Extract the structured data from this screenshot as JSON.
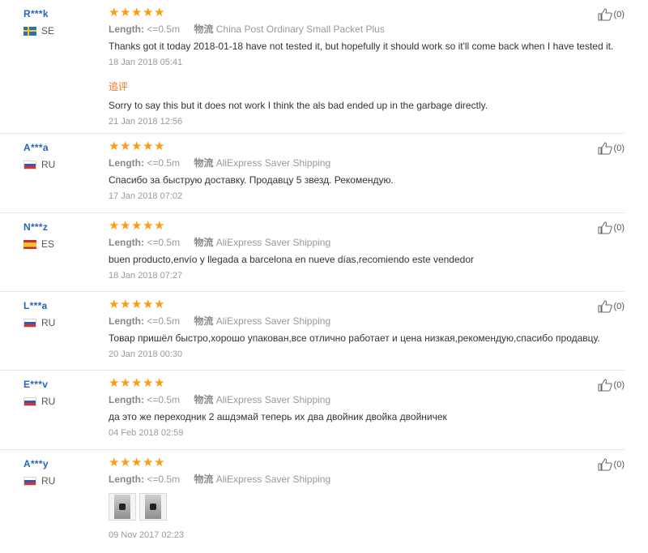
{
  "labels": {
    "length": "Length:",
    "logistics": "物流",
    "followup": "追评"
  },
  "reviews": [
    {
      "user": "R***k",
      "country": "SE",
      "flag": "se",
      "stars": 5,
      "length": "<=0.5m",
      "shipping": "China Post Ordinary Small Packet Plus",
      "text": "Thanks got it today 2018-01-18 have not tested it, but hopefully it should work so it'll come back when I have tested it.",
      "date": "18 Jan 2018 05:41",
      "followup_text": "Sorry to say this but it does not work I think the als bad ended up in the garbage directly.",
      "followup_date": "21 Jan 2018 12:56",
      "likes": "(0)"
    },
    {
      "user": "A***a",
      "country": "RU",
      "flag": "ru",
      "stars": 5,
      "length": "<=0.5m",
      "shipping": "AliExpress Saver Shipping",
      "text": "Спасибо за быструю доставку. Продавцу 5 звезд. Рекомендую.",
      "date": "17 Jan 2018 07:02",
      "likes": "(0)"
    },
    {
      "user": "N***z",
      "country": "ES",
      "flag": "es",
      "stars": 5,
      "length": "<=0.5m",
      "shipping": "AliExpress Saver Shipping",
      "text": "buen producto,envío y llegada a barcelona en nueve días,recomiendo este vendedor",
      "date": "18 Jan 2018 07:27",
      "likes": "(0)"
    },
    {
      "user": "L***a",
      "country": "RU",
      "flag": "ru",
      "stars": 5,
      "length": "<=0.5m",
      "shipping": "AliExpress Saver Shipping",
      "text": "Товар пришёл быстро,хорошо упакован,все отлично работает и цена низкая,рекомендую,спасибо продавцу.",
      "date": "20 Jan 2018 00:30",
      "likes": "(0)"
    },
    {
      "user": "E***v",
      "country": "RU",
      "flag": "ru",
      "stars": 5,
      "length": "<=0.5m",
      "shipping": "AliExpress Saver Shipping",
      "text": "да это же переходник 2 ашдэмай теперь их два двойник двойка двойничек",
      "date": "04 Feb 2018 02:59",
      "likes": "(0)"
    },
    {
      "user": "A***y",
      "country": "RU",
      "flag": "ru",
      "stars": 5,
      "length": "<=0.5m",
      "shipping": "AliExpress Saver Shipping",
      "photos": 2,
      "date": "09 Nov 2017 02:23",
      "likes": "(0)"
    }
  ],
  "colors": {
    "star": "#ff9b11",
    "username": "#2a63b8",
    "followup": "#f1761e"
  }
}
